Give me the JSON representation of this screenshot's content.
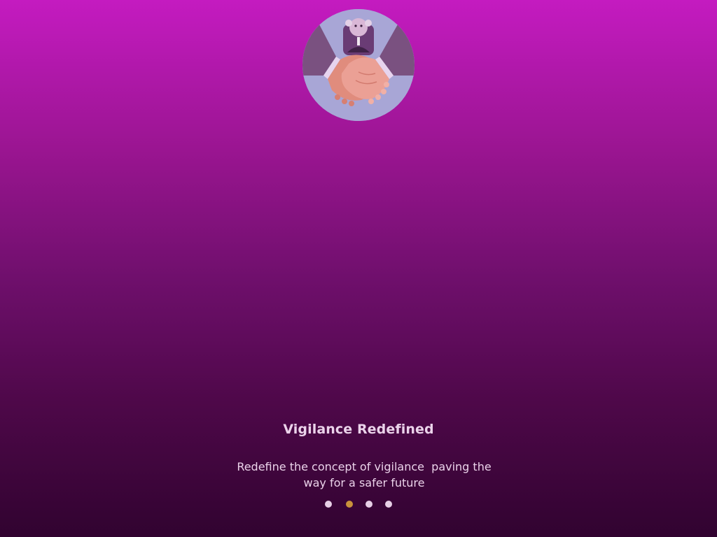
{
  "onboarding": {
    "title": "Vigilance Redefined",
    "subtitle": "Redefine the concept of vigilance  paving the way for a safer future",
    "illustration_icon": "handshake-icon",
    "pagination": {
      "total": 4,
      "active_index": 1
    }
  },
  "colors": {
    "gradient_top": "#c41bc0",
    "gradient_bottom": "#310330",
    "text": "#ebd3ea",
    "dot_inactive": "#e7cfe6",
    "dot_active": "#c9923b",
    "illustration_bg": "#a8a6d6"
  }
}
